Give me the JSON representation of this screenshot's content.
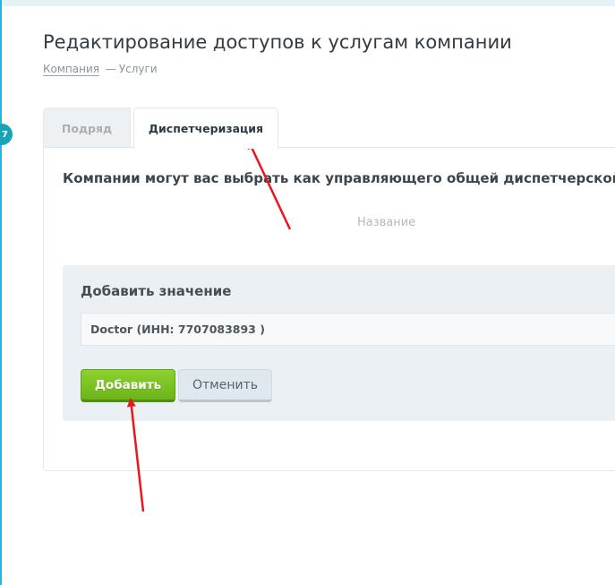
{
  "step": {
    "number": "7"
  },
  "page": {
    "title": "Редактирование доступов к услугам компании",
    "breadcrumb": {
      "link": "Компания",
      "separator": "—",
      "current": "Услуги"
    }
  },
  "tabs": [
    {
      "label": "Подряд",
      "active": false
    },
    {
      "label": "Диспетчеризация",
      "active": true
    }
  ],
  "card": {
    "heading": "Компании могут вас выбрать как управляющего общей диспетчерской",
    "column_header": "Название"
  },
  "add_form": {
    "title": "Добавить значение",
    "input_value": "Doctor (ИНН: 7707083893 )",
    "add_label": "Добавить",
    "cancel_label": "Отменить"
  },
  "colors": {
    "accent": "#29b3d6",
    "add_button": "#7cc224",
    "annotation_arrow": "#e8171b"
  }
}
